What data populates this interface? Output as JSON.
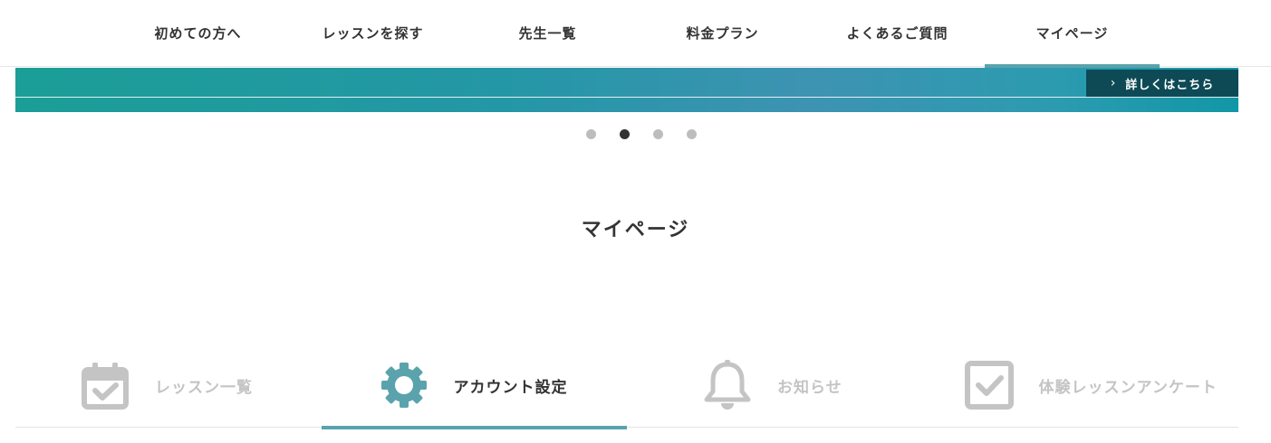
{
  "nav": {
    "items": [
      {
        "label": "初めての方へ"
      },
      {
        "label": "レッスンを探す"
      },
      {
        "label": "先生一覧"
      },
      {
        "label": "料金プラン"
      },
      {
        "label": "よくあるご質問"
      },
      {
        "label": "マイページ",
        "active": true
      }
    ]
  },
  "banner": {
    "button_label": "詳しくはこちら",
    "button_icon": "chevron-right-icon"
  },
  "carousel": {
    "slide_count": 4,
    "active_index": 2
  },
  "page": {
    "title": "マイページ"
  },
  "tabs": [
    {
      "label": "レッスン一覧",
      "icon": "calendar-check-icon",
      "active": false
    },
    {
      "label": "アカウント設定",
      "icon": "gear-icon",
      "active": true
    },
    {
      "label": "お知らせ",
      "icon": "bell-icon",
      "active": false
    },
    {
      "label": "体験レッスンアンケート",
      "icon": "checkbox-icon",
      "active": false
    }
  ],
  "colors": {
    "accent": "#5aa3ac",
    "inactive": "#c4c4c4",
    "text": "#333333",
    "banner_button": "#0d4a55"
  }
}
